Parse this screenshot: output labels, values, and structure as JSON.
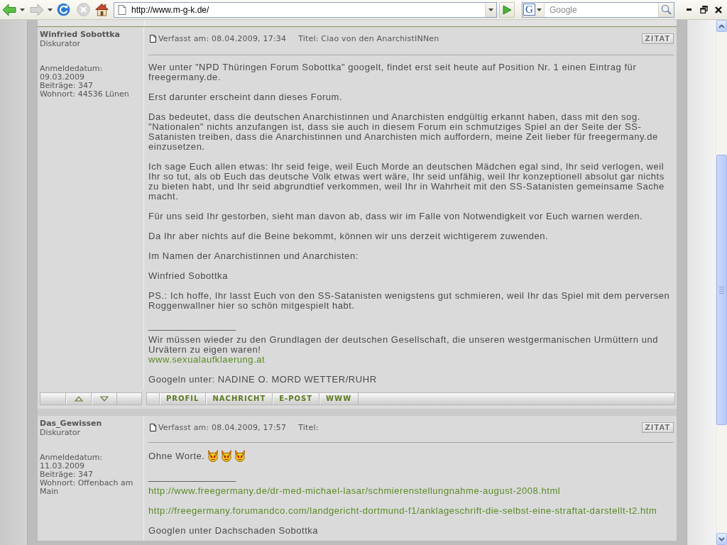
{
  "browser": {
    "nav": [
      {
        "kind": "back",
        "disabled": false
      },
      {
        "kind": "forward",
        "disabled": true
      },
      {
        "kind": "reload",
        "disabled": false
      },
      {
        "kind": "stop",
        "disabled": true
      },
      {
        "kind": "home",
        "disabled": false
      }
    ],
    "address": "http://www.m-g-k.de/",
    "search_engine": "G",
    "search_placeholder": "Google"
  },
  "posts": [
    {
      "author": "Winfried Sobottka",
      "rank": "Diskurator",
      "details": [
        "Anmeldedatum: 09.03.2009",
        "Beiträge: 347",
        "Wohnort: 44536 Lünen"
      ],
      "posted": "Verfasst am: 08.04.2009, 17:34",
      "title": "Titel: Ciao von den AnarchistINNen",
      "quote_button": "ZITAT",
      "body": [
        {
          "text": "Wer unter \"NPD Thüringen Forum Sobottka\" googelt, findet erst seit heute auf Position Nr. 1 einen Eintrag für freegermany.de."
        },
        {
          "text": "Erst darunter erscheint dann dieses Forum."
        },
        {
          "text": "Das bedeutet, dass die deutschen Anarchistinnen und Anarchisten endgültig erkannt haben, dass mit den sog. \"Nationalen\" nichts anzufangen ist, dass sie auch in diesem Forum ein schmutziges Spiel an der Seite der SS-Satanisten treiben, dass die Anarchistinnen und Anarchisten mich auffordern, meine Zeit lieber für freegermany.de einzusetzen."
        },
        {
          "text": "Ich sage Euch allen etwas: Ihr seid feige, weil Euch Morde an deutschen Mädchen egal sind, Ihr seid verlogen, weil Ihr so tut, als ob Euch das deutsche Volk etwas wert wäre, Ihr seid unfähig, weil Ihr konzeptionell absolut gar nichts zu bieten habt, und Ihr seid abgrundtief verkommen, weil Ihr in Wahrheit mit den SS-Satanisten gemeinsame Sache macht."
        },
        {
          "text": "Für uns seid Ihr gestorben, sieht man davon ab, dass wir im Falle von Notwendigkeit vor Euch warnen werden."
        },
        {
          "text": "Da Ihr aber nichts auf die Beine bekommt, können wir uns derzeit wichtigerem zuwenden."
        },
        {
          "text": "Im Namen der Anarchistinnen und Anarchisten:"
        },
        {
          "text": "Winfried Sobottka"
        },
        {
          "text": "PS.: Ich hoffe, Ihr lasst Euch von den SS-Satanisten wenigstens gut schmieren, weil Ihr das Spiel mit dem perversen Roggenwallner hier so schön mitgespielt habt."
        }
      ],
      "signature_rule": "_________________",
      "signature": [
        [
          {
            "kind": "text",
            "text": "Wir müssen wieder zu den Grundlagen der deutschen Gesellschaft, die unseren westgermanischen Urmüttern und Urvätern zu eigen waren!"
          },
          {
            "kind": "link",
            "text": "www.sexualaufklaerung.at"
          }
        ],
        [
          {
            "kind": "text",
            "text": "Googeln unter: NADINE O. MORD WETTER/RUHR"
          }
        ]
      ],
      "actions": [
        "PROFIL",
        "NACHRICHT",
        "E-POST",
        "WWW"
      ]
    },
    {
      "author": "Das_Gewissen",
      "rank": "Diskurator",
      "details": [
        "Anmeldedatum: 11.03.2009",
        "Beiträge: 347",
        "Wohnort: Offenbach am Main"
      ],
      "posted": "Verfasst am: 08.04.2009, 17:57",
      "title": "Titel:",
      "quote_button": "ZITAT",
      "body": [
        {
          "text": "Ohne Worte.",
          "smilies": [
            {
              "kind": "devil"
            },
            {
              "kind": "devil"
            },
            {
              "kind": "devil"
            }
          ]
        }
      ],
      "signature_rule": "_________________",
      "signature": [
        [
          {
            "kind": "link",
            "text": "http://www.freegermany.de/dr-med-michael-lasar/schmierenstellungnahme-august-2008.html"
          }
        ],
        [
          {
            "kind": "link",
            "text": "http://freegermany.forumandco.com/landgericht-dortmund-f1/anklageschrift-die-selbst-eine-straftat-darstellt-t2.htm"
          }
        ],
        [
          {
            "kind": "text",
            "text": "Googlen unter Dachschaden Sobottka"
          }
        ]
      ]
    }
  ]
}
